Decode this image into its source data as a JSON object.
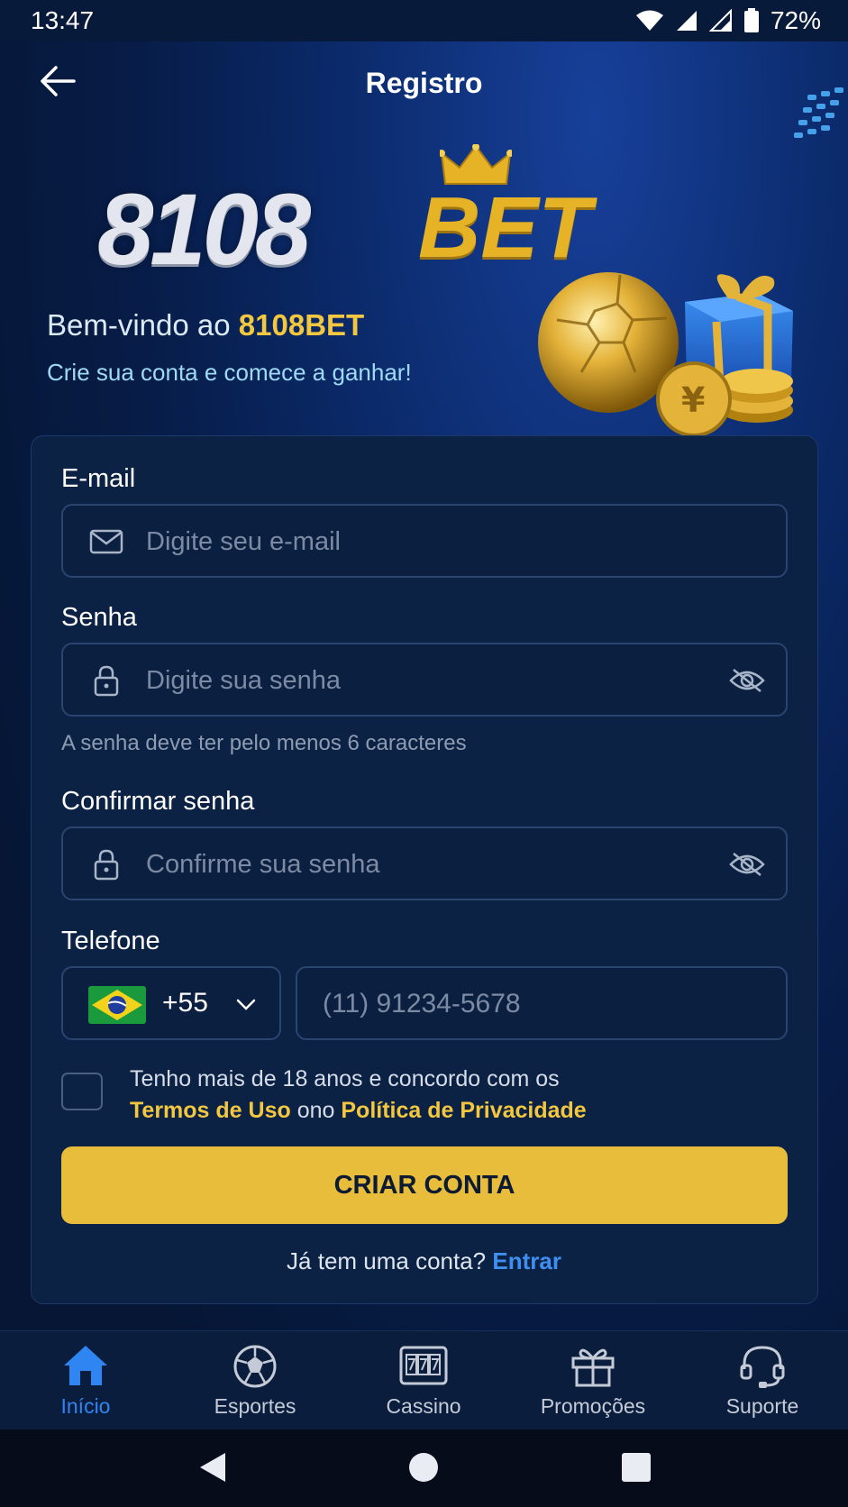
{
  "status_bar": {
    "time": "13:47",
    "battery": "72%"
  },
  "header": {
    "title": "Registro"
  },
  "logo": {
    "number": "8108",
    "suffix": "BET"
  },
  "welcome": {
    "title_prefix": "Bem-vindo ao",
    "title_brand": "8108BET",
    "subtitle": "Crie sua conta e comece a ganhar!"
  },
  "form": {
    "email": {
      "label": "E-mail",
      "placeholder": "Digite seu e-mail"
    },
    "password": {
      "label": "Senha",
      "placeholder": "Digite sua senha",
      "hint": "A senha deve ter pelo menos 6 caracteres"
    },
    "confirm": {
      "label": "Confirmar senha",
      "placeholder": "Confirme sua senha"
    },
    "phone": {
      "label": "Telefone",
      "country_code": "+55",
      "placeholder": "(11) 91234-5678"
    },
    "terms": {
      "line1": "Tenho mais de 18 anos e concordo com os",
      "terms_link": "Termos de Uso",
      "connector": "ono",
      "privacy_link": "Política de Privacidade",
      "checked": false
    },
    "submit_label": "CRIAR CONTA",
    "login_prompt": "Já tem uma conta?",
    "login_link": "Entrar"
  },
  "bottom_nav": [
    {
      "label": "Início",
      "icon": "home-icon",
      "active": true
    },
    {
      "label": "Esportes",
      "icon": "soccer-ball-icon",
      "active": false
    },
    {
      "label": "Cassino",
      "icon": "slot-machine-icon",
      "active": false
    },
    {
      "label": "Promoções",
      "icon": "gift-icon",
      "active": false
    },
    {
      "label": "Suporte",
      "icon": "headset-icon",
      "active": false
    }
  ],
  "colors": {
    "accent_gold": "#e8bd3c",
    "link_blue": "#3f8ff1",
    "background": "#061534",
    "card": "#0c2245"
  }
}
